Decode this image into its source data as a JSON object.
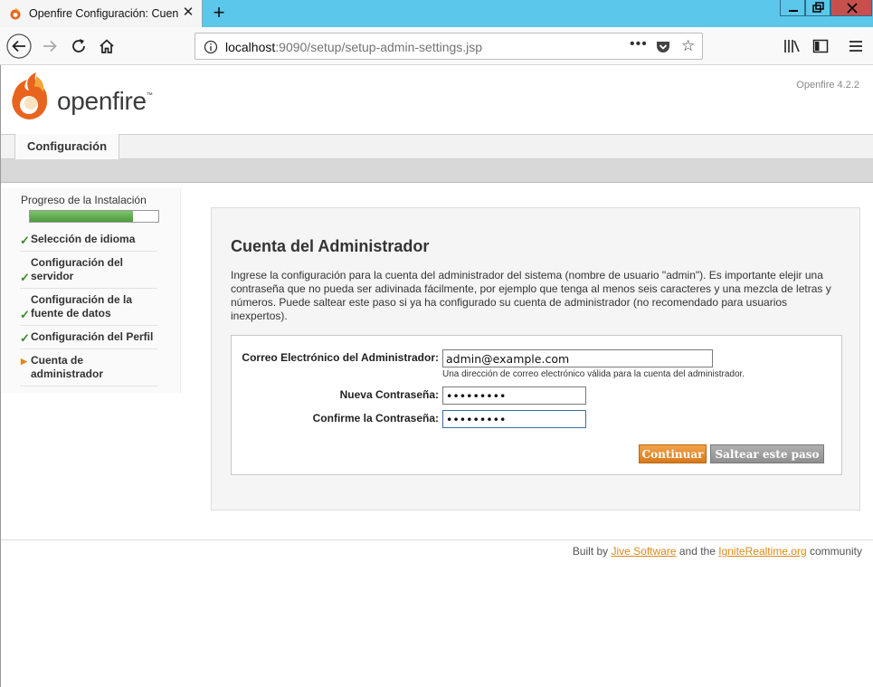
{
  "browser": {
    "tab_title": "Openfire Configuración: Cuent",
    "url_host": "localhost",
    "url_path": ":9090/setup/setup-admin-settings.jsp",
    "more_label": "•••"
  },
  "header": {
    "logo_text": "openfire",
    "logo_tm": "™",
    "version": "Openfire 4.2.2"
  },
  "nav": {
    "tab_label": "Configuración"
  },
  "sidebar": {
    "title": "Progreso de la Instalación",
    "progress_fraction": 0.8,
    "steps": [
      {
        "label": "Selección de idioma",
        "status": "done"
      },
      {
        "label": "Configuración del servidor",
        "status": "done"
      },
      {
        "label": "Configuración de la fuente de datos",
        "status": "done"
      },
      {
        "label": "Configuración del Perfil",
        "status": "done"
      },
      {
        "label": "Cuenta de administrador",
        "status": "current"
      }
    ],
    "check_mark": "✓",
    "current_mark": "▶"
  },
  "main": {
    "title": "Cuenta del Administrador",
    "description": "Ingrese la configuración para la cuenta del administrador del sistema (nombre de usuario \"admin\"). Es importante elejir una contraseña que no pueda ser adivinada fácilmente, por ejemplo que tenga al menos seis caracteres y una mezcla de letras y números. Puede saltear este paso si ya ha configurado su cuenta de administrador (no recomendado para usuarios inexpertos).",
    "email_label": "Correo Electrónico del Administrador:",
    "email_value": "admin@example.com",
    "email_hint": "Una dirección de correo electrónico válida para la cuenta del administrador.",
    "password_label": "Nueva Contraseña:",
    "password_value": "•••••••••",
    "confirm_label": "Confirme la Contraseña:",
    "confirm_value": "•••••••••",
    "continue_button": "Continuar",
    "skip_button": "Saltear este paso"
  },
  "footer": {
    "prefix": "Built by ",
    "link1": "Jive Software",
    "middle": " and the ",
    "link2": "IgniteRealtime.org",
    "suffix": " community"
  },
  "colors": {
    "accent": "#d98a1a",
    "browser_titlebar": "#5bc7eb",
    "progress_green": "#5aa84a"
  }
}
